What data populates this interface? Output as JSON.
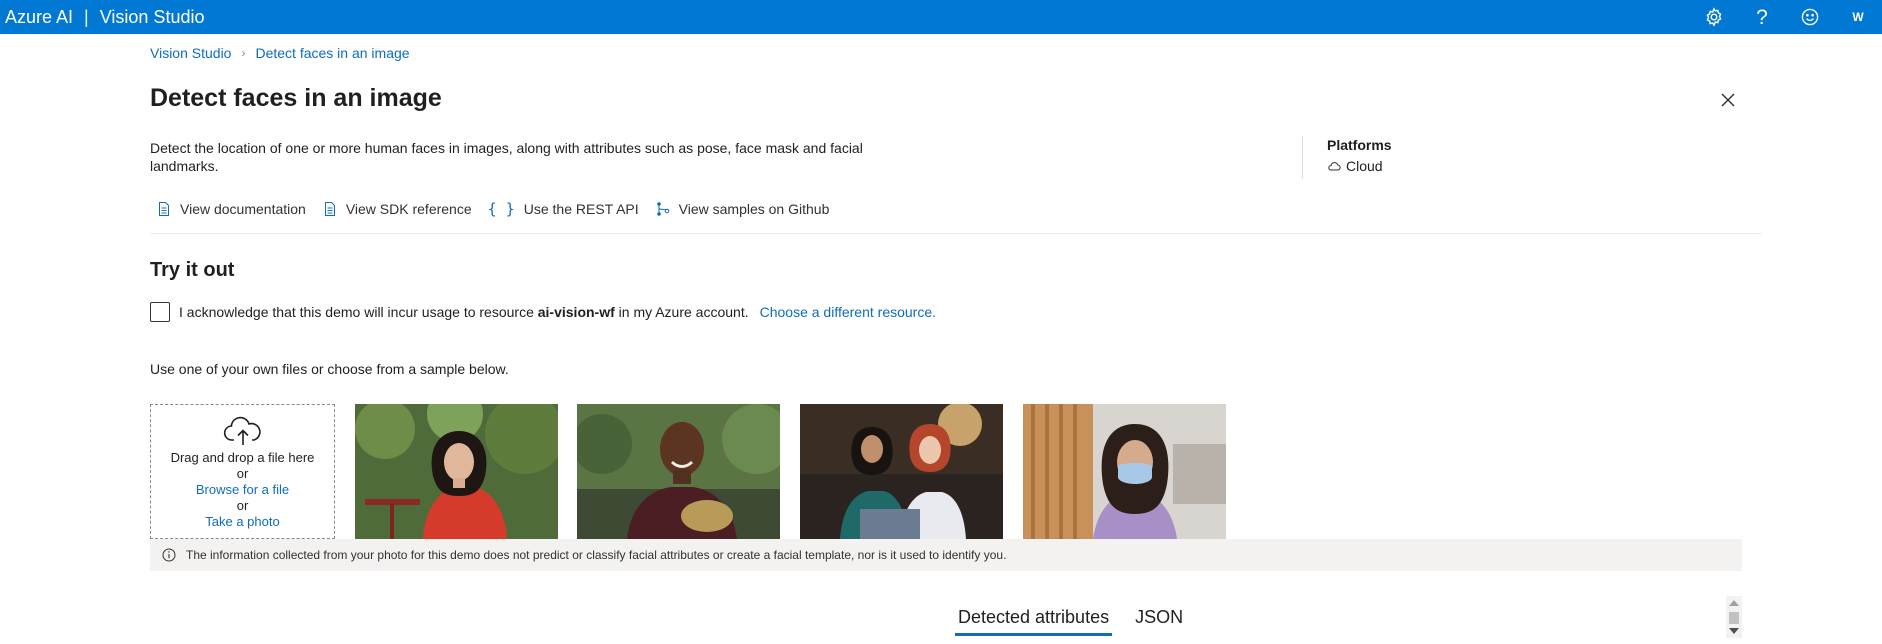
{
  "topbar": {
    "brand": "Azure AI",
    "separator": "|",
    "product": "Vision Studio",
    "avatar_initial": "W",
    "icons": [
      "gear-icon",
      "help-icon",
      "feedback-smiley-icon"
    ]
  },
  "breadcrumb": {
    "items": [
      "Vision Studio",
      "Detect faces in an image"
    ],
    "separator": "›"
  },
  "page": {
    "title": "Detect faces in an image",
    "description": "Detect the location of one or more human faces in images, along with attributes such as pose, face mask and facial landmarks."
  },
  "platforms": {
    "title": "Platforms",
    "item": "Cloud"
  },
  "links": {
    "documentation": "View documentation",
    "sdk": "View SDK reference",
    "rest": "Use the REST API",
    "samples": "View samples on Github",
    "braces": "{ }"
  },
  "tryout": {
    "title": "Try it out",
    "ack_prefix": "I acknowledge that this demo will incur usage to resource",
    "resource": "ai-vision-wf",
    "ack_suffix": "in my Azure account.",
    "choose_resource": "Choose a different resource.",
    "use_files": "Use one of your own files or choose from a sample below."
  },
  "dropzone": {
    "line1": "Drag and drop a file here",
    "or1": "or",
    "browse": "Browse for a file",
    "or2": "or",
    "take_photo": "Take a photo"
  },
  "info": {
    "text": "The information collected from your photo for this demo does not predict or classify facial attributes or create a facial template, nor is it used to identify you."
  },
  "tabs": {
    "items": [
      "Detected attributes",
      "JSON"
    ],
    "active": "Detected attributes"
  },
  "colors": {
    "topbar": "#0078d4",
    "link": "#0f6cbd",
    "info_bg": "#f3f2f1"
  }
}
